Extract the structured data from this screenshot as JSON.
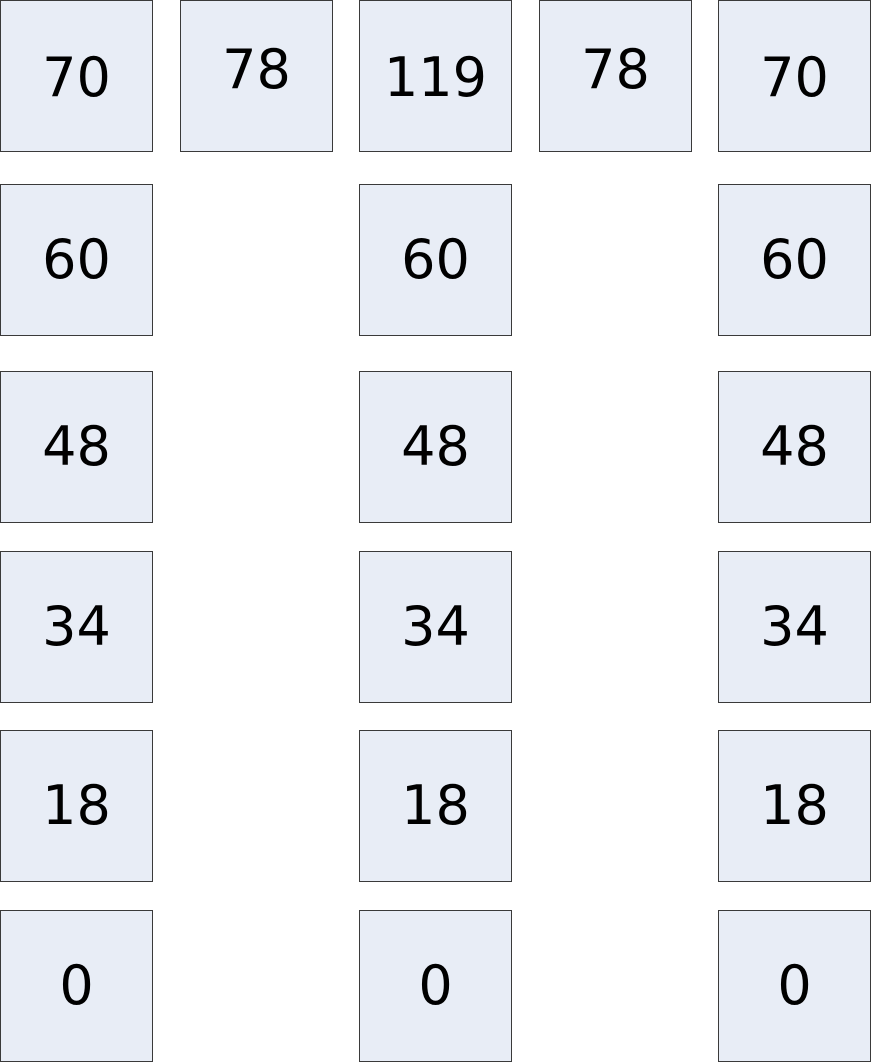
{
  "grid": {
    "row0": [
      "70",
      "78",
      "119",
      "78",
      "70"
    ],
    "left_column": [
      "60",
      "48",
      "34",
      "18",
      "0"
    ],
    "middle_column": [
      "60",
      "48",
      "34",
      "18",
      "0"
    ],
    "right_column": [
      "60",
      "48",
      "34",
      "18",
      "0"
    ]
  },
  "colors": {
    "cell_fill": "#e8edf6",
    "cell_border": "#3a3a3a",
    "text": "#000000"
  }
}
